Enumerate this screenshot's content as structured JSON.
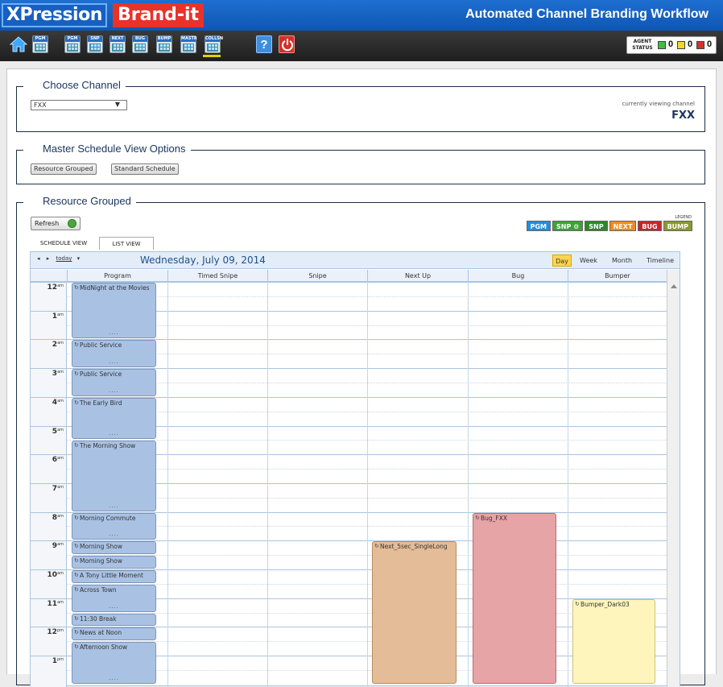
{
  "header": {
    "logo_left": "XPression",
    "logo_right": "Brand-it",
    "app_title": "Automated Channel Branding Workflow"
  },
  "toolbar": {
    "buttons": [
      {
        "id": "home",
        "icon": "home-icon"
      },
      {
        "id": "pgm",
        "label": "PGM"
      },
      {
        "id": "pgm2",
        "label": "PGM"
      },
      {
        "id": "snp",
        "label": "SNP"
      },
      {
        "id": "next",
        "label": "NEXT"
      },
      {
        "id": "bug",
        "label": "BUG"
      },
      {
        "id": "bump",
        "label": "BUMP"
      },
      {
        "id": "mastr",
        "label": "MASTR"
      },
      {
        "id": "collsn",
        "label": "COLLSN"
      },
      {
        "id": "help",
        "label": "?"
      },
      {
        "id": "power",
        "icon": "power-icon"
      }
    ],
    "agent_status": {
      "label_line1": "AGENT",
      "label_line2": "STATUS",
      "green": "0",
      "yellow": "0",
      "red": "0"
    }
  },
  "choose_channel": {
    "legend": "Choose Channel",
    "selected": "FXX",
    "currently_viewing_label": "currently viewing channel",
    "currently_viewing_value": "FXX"
  },
  "view_options": {
    "legend": "Master Schedule View Options",
    "buttons": [
      "Resource Grouped",
      "Standard Schedule"
    ]
  },
  "resource_grouped": {
    "legend": "Resource Grouped",
    "refresh_label": "Refresh",
    "legend_label": "LEGEND",
    "legend_items": [
      {
        "label": "PGM",
        "color": "#1f8fe0"
      },
      {
        "label": "SNP ⚙",
        "color": "#3aa535"
      },
      {
        "label": "SNP",
        "color": "#2a8a2a"
      },
      {
        "label": "NEXT",
        "color": "#f28a1c"
      },
      {
        "label": "BUG",
        "color": "#c8242c"
      },
      {
        "label": "BUMP",
        "color": "#8a9a2a"
      }
    ],
    "tabs": [
      "SCHEDULE VIEW",
      "LIST VIEW"
    ]
  },
  "calendar": {
    "nav_today": "today",
    "date": "Wednesday, July 09, 2014",
    "views": [
      "Day",
      "Week",
      "Month",
      "Timeline"
    ],
    "active_view": "Day",
    "columns": [
      "Program",
      "Timed Snipe",
      "Snipe",
      "Next Up",
      "Bug",
      "Bumper"
    ],
    "hours": [
      {
        "h": "12",
        "ap": "am"
      },
      {
        "h": "1",
        "ap": "am"
      },
      {
        "h": "2",
        "ap": "am"
      },
      {
        "h": "3",
        "ap": "am"
      },
      {
        "h": "4",
        "ap": "am"
      },
      {
        "h": "5",
        "ap": "am"
      },
      {
        "h": "6",
        "ap": "am"
      },
      {
        "h": "7",
        "ap": "am"
      },
      {
        "h": "8",
        "ap": "am"
      },
      {
        "h": "9",
        "ap": "am"
      },
      {
        "h": "10",
        "ap": "am"
      },
      {
        "h": "11",
        "ap": "am"
      },
      {
        "h": "12",
        "ap": "pm"
      },
      {
        "h": "1",
        "ap": "pm"
      }
    ],
    "events": [
      {
        "title": "MidNight at the Movies",
        "col": 0,
        "start": 0,
        "end": 2
      },
      {
        "title": "Public Service",
        "col": 0,
        "start": 2,
        "end": 3
      },
      {
        "title": "Public Service",
        "col": 0,
        "start": 3,
        "end": 4
      },
      {
        "title": "The Early Bird",
        "col": 0,
        "start": 4,
        "end": 5.5
      },
      {
        "title": "The Morning Show",
        "col": 0,
        "start": 5.5,
        "end": 8
      },
      {
        "title": "Morning Commute",
        "col": 0,
        "start": 8,
        "end": 9
      },
      {
        "title": "Morning Show",
        "col": 0,
        "start": 9,
        "end": 9.5
      },
      {
        "title": "Morning Show",
        "col": 0,
        "start": 9.5,
        "end": 10
      },
      {
        "title": "A Tony Little Moment",
        "col": 0,
        "start": 10,
        "end": 10.5
      },
      {
        "title": "Across Town",
        "col": 0,
        "start": 10.5,
        "end": 11.5
      },
      {
        "title": "11:30 Break",
        "col": 0,
        "start": 11.5,
        "end": 12
      },
      {
        "title": "News at Noon",
        "col": 0,
        "start": 12,
        "end": 12.5
      },
      {
        "title": "Afternoon Show",
        "col": 0,
        "start": 12.5,
        "end": 14
      },
      {
        "title": "Next_5sec_SingleLong",
        "col": 3,
        "start": 9,
        "end": 14,
        "style": "evb"
      },
      {
        "title": "Bug_FXX",
        "col": 4,
        "start": 8,
        "end": 14,
        "style": "evr"
      },
      {
        "title": "Bumper_Dark03",
        "col": 5,
        "start": 11,
        "end": 14,
        "style": "evy"
      }
    ]
  }
}
